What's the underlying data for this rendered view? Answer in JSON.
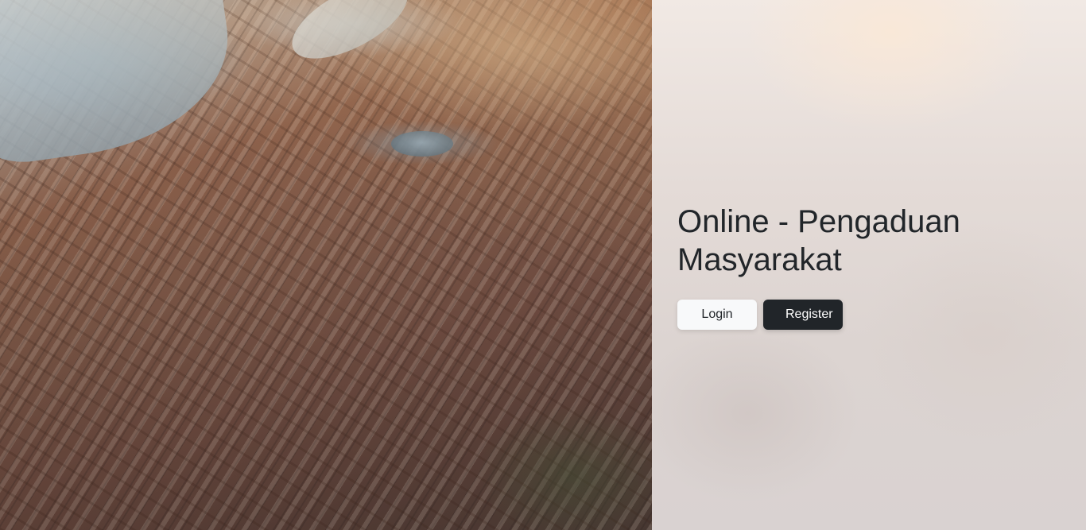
{
  "hero": {
    "title_line_1": "Online - Pengaduan",
    "title_line_2": "Masyarakat"
  },
  "actions": {
    "login_label": "Login",
    "register_label": "Register"
  },
  "colors": {
    "title_text": "#212529",
    "login_button_bg": "#f8f9fa",
    "register_button_bg": "#212529",
    "register_button_text": "#ffffff"
  }
}
